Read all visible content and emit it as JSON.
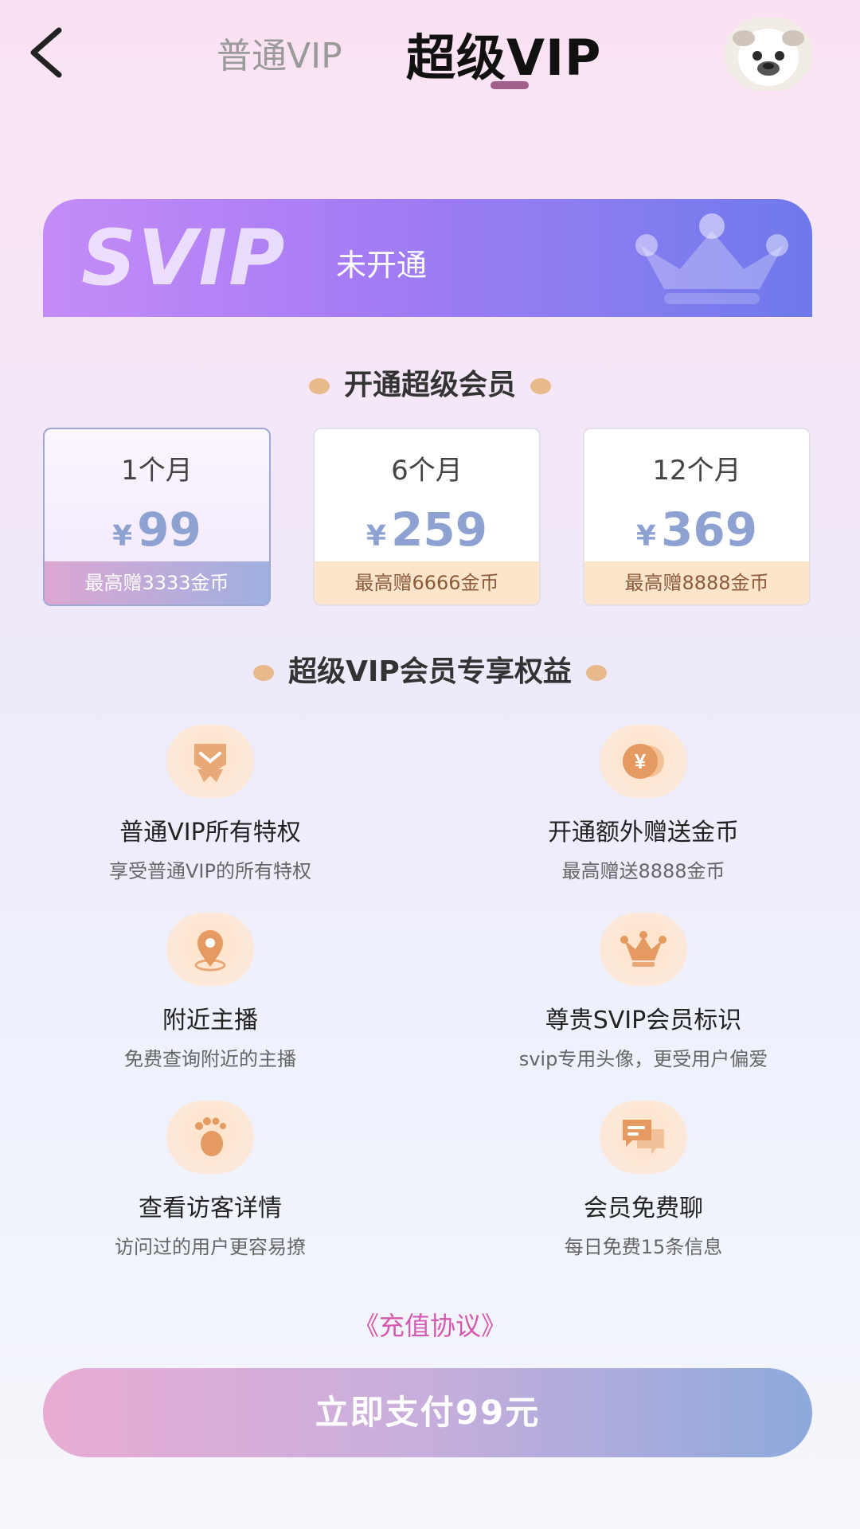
{
  "header": {
    "tabs": [
      {
        "label": "普通VIP",
        "active": false
      },
      {
        "label": "超级VIP",
        "active": true
      }
    ],
    "icons": {
      "back": "chevron-left-icon",
      "avatar": "user-avatar"
    }
  },
  "banner": {
    "logo_text": "SVIP",
    "status": "未开通",
    "icon": "crown-icon"
  },
  "plans_section": {
    "title": "开通超级会员",
    "plans": [
      {
        "duration": "1个月",
        "currency": "¥",
        "price": "99",
        "bonus": "最高赠3333金币",
        "selected": true
      },
      {
        "duration": "6个月",
        "currency": "¥",
        "price": "259",
        "bonus": "最高赠6666金币",
        "selected": false
      },
      {
        "duration": "12个月",
        "currency": "¥",
        "price": "369",
        "bonus": "最高赠8888金币",
        "selected": false
      }
    ]
  },
  "benefits_section": {
    "title": "超级VIP会员专享权益",
    "items": [
      {
        "title": "普通VIP所有特权",
        "desc": "享受普通VIP的所有特权",
        "icon": "medal-icon"
      },
      {
        "title": "开通额外赠送金币",
        "desc": "最高赠送8888金币",
        "icon": "coin-icon"
      },
      {
        "title": "附近主播",
        "desc": "免费查询附近的主播",
        "icon": "location-pin-icon"
      },
      {
        "title": "尊贵SVIP会员标识",
        "desc": "svip专用头像，更受用户偏爱",
        "icon": "crown-icon"
      },
      {
        "title": "查看访客详情",
        "desc": "访问过的用户更容易撩",
        "icon": "footprint-icon"
      },
      {
        "title": "会员免费聊",
        "desc": "每日免费15条信息",
        "icon": "chat-bubbles-icon"
      }
    ]
  },
  "footer": {
    "agreement_link": "《充值协议》",
    "pay_button": "立即支付99元"
  },
  "colors": {
    "accent_pink": "#d45ab0",
    "price_blue": "#8ea2d1",
    "banner_start": "#c58cf7",
    "banner_end": "#6e79ec",
    "bonus_bg": "#fde5cc"
  }
}
